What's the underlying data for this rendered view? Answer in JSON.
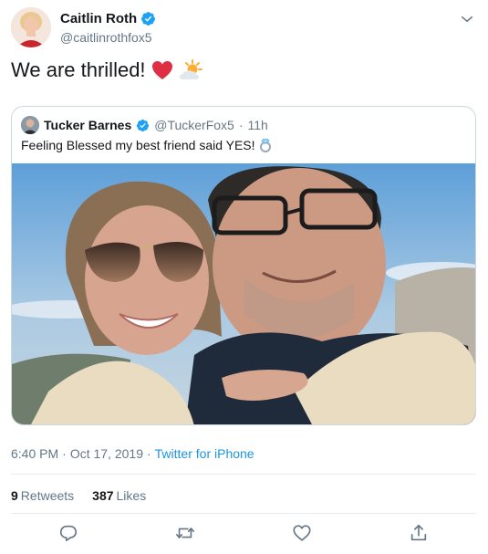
{
  "author": {
    "name": "Caitlin Roth",
    "handle": "@caitlinrothfox5"
  },
  "tweet": {
    "text": "We are thrilled!",
    "emojis": [
      "red-heart",
      "sun-behind-cloud"
    ]
  },
  "quoted": {
    "name": "Tucker Barnes",
    "handle": "@TuckerFox5",
    "separator": "·",
    "time": "11h",
    "text": "Feeling Blessed my best friend said YES!",
    "emoji": "ring"
  },
  "meta": {
    "time": "6:40 PM",
    "separator1": "·",
    "date": "Oct 17, 2019",
    "separator2": "·",
    "source": "Twitter for iPhone"
  },
  "stats": {
    "retweets_count": "9",
    "retweets_label": "Retweets",
    "likes_count": "387",
    "likes_label": "Likes"
  },
  "colors": {
    "verified": "#1da1f2",
    "link": "#1b95e0",
    "secondary": "#657786",
    "heart": "#e0245e"
  },
  "icons": [
    "caret-down-icon",
    "reply-icon",
    "retweet-icon",
    "like-icon",
    "share-icon"
  ]
}
